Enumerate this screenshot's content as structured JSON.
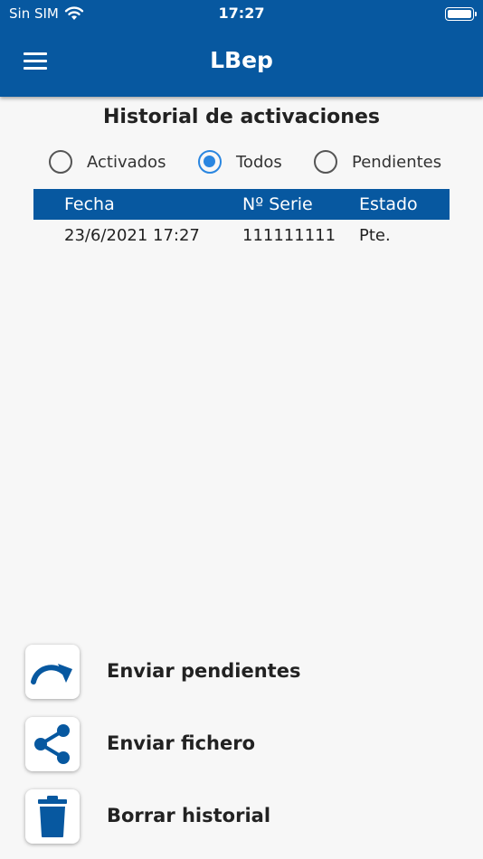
{
  "status_bar": {
    "carrier": "Sin SIM",
    "time": "17:27"
  },
  "header": {
    "title": "LBep",
    "menu_icon": "hamburger-menu-icon"
  },
  "page": {
    "title": "Historial de activaciones"
  },
  "filters": [
    {
      "label": "Activados",
      "checked": false
    },
    {
      "label": "Todos",
      "checked": true
    },
    {
      "label": "Pendientes",
      "checked": false
    }
  ],
  "table": {
    "columns": [
      "Fecha",
      "Nº Serie",
      "Estado"
    ],
    "rows": [
      [
        "23/6/2021 17:27",
        "111111111",
        "Pte."
      ]
    ]
  },
  "actions": [
    {
      "label": "Enviar pendientes",
      "icon": "redo-arrow-icon"
    },
    {
      "label": "Enviar fichero",
      "icon": "share-icon"
    },
    {
      "label": "Borrar historial",
      "icon": "trash-icon"
    }
  ],
  "colors": {
    "primary": "#0758a0",
    "radio_active": "#2a86e0",
    "background": "#f7f7f7"
  }
}
